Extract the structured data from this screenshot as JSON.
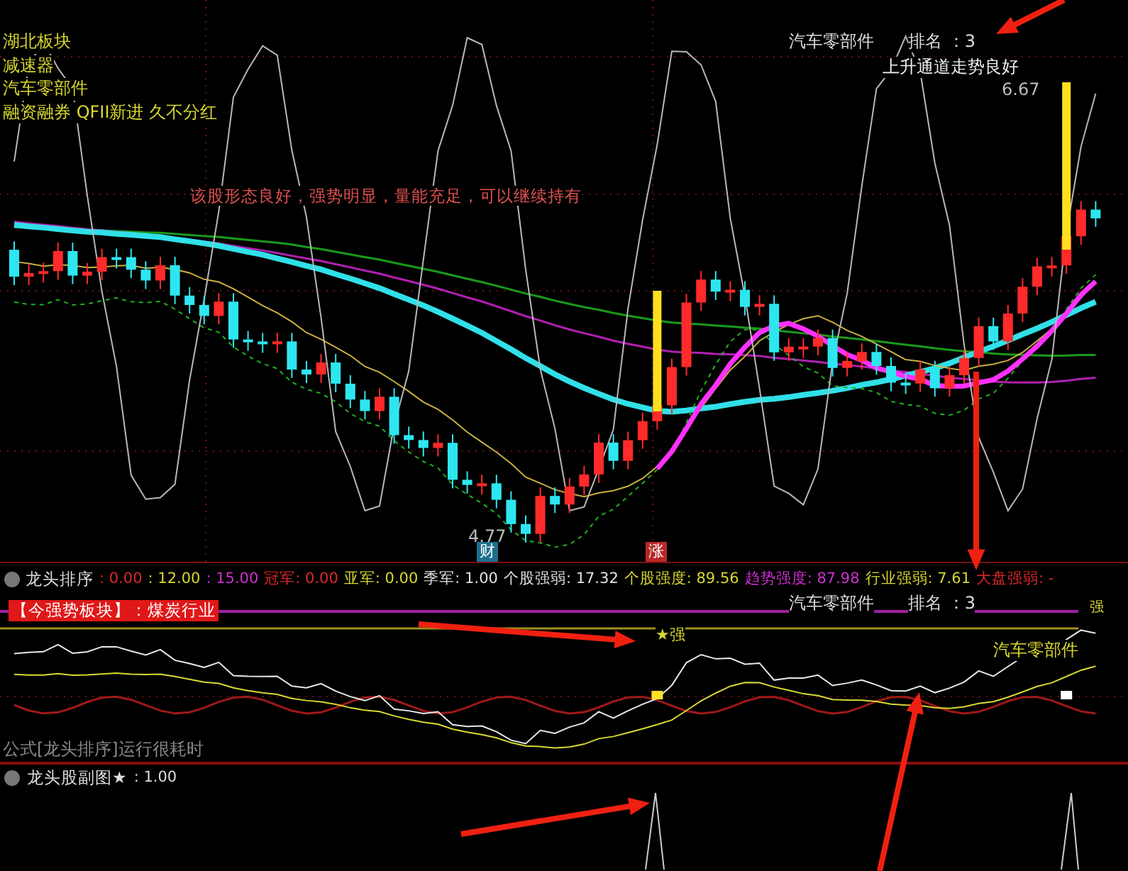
{
  "main_panel": {
    "tags": [
      "湖北板块",
      "减速器",
      "汽车零部件",
      "融资融券 QFII新进 久不分红"
    ],
    "comment": "该股形态良好，强势明显，量能充足，可以继续持有",
    "sector_label": "汽车零部件",
    "rank_label": "排名 ：3",
    "trend_note": "上升通道走势良好",
    "high_price": "6.67",
    "low_price": "4.77",
    "markers": [
      {
        "text": "财",
        "color": "#1f6f8f"
      },
      {
        "text": "涨",
        "color": "#b82828"
      }
    ]
  },
  "indicator_bar": {
    "name": "龙头排序",
    "items": [
      {
        "text": ": 0.00",
        "color": "#e02828"
      },
      {
        "text": ": 12.00",
        "color": "#d8d830"
      },
      {
        "text": ": 15.00",
        "color": "#d030d0"
      },
      {
        "text": "冠军: 0.00",
        "color": "#e02828"
      },
      {
        "text": "亚军: 0.00",
        "color": "#d8d830"
      },
      {
        "text": "季军: 1.00",
        "color": "#e0e0e0"
      },
      {
        "text": "个股强弱: 17.32",
        "color": "#e0e0e0"
      },
      {
        "text": "个股强度: 89.56",
        "color": "#d8d830"
      },
      {
        "text": "趋势强度: 87.98",
        "color": "#d030d0"
      },
      {
        "text": "行业强弱: 7.61",
        "color": "#d8d830"
      },
      {
        "text": "大盘强弱: -",
        "color": "#e02828"
      }
    ]
  },
  "sub_panel": {
    "strong_sector": "【今强势板块】：煤炭行业",
    "sector_label": "汽车零部件",
    "rank_label": "排名 ：3",
    "line_label": "汽车零部件",
    "peak_label": "★强",
    "end_label": "强",
    "note": "公式[龙头排序]运行很耗时"
  },
  "bottom_panel": {
    "name": "龙头股副图★",
    "value": ": 1.00"
  }
}
